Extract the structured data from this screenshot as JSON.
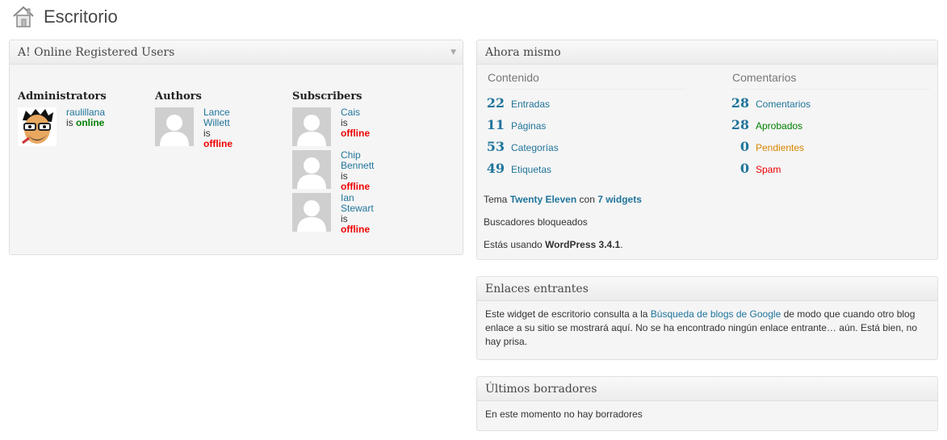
{
  "page": {
    "title": "Escritorio"
  },
  "online_users": {
    "title": "A! Online Registered Users",
    "columns": [
      {
        "title": "Administrators",
        "users": [
          {
            "name": "raulillana",
            "prefix": "is",
            "status": "online"
          }
        ]
      },
      {
        "title": "Authors",
        "users": [
          {
            "name": "Lance Willett",
            "prefix": "is",
            "status": "offline"
          }
        ]
      },
      {
        "title": "Subscribers",
        "users": [
          {
            "name": "Cais",
            "prefix": "is",
            "status": "offline"
          },
          {
            "name": "Chip Bennett",
            "prefix": "is",
            "status": "offline"
          },
          {
            "name": "Ian Stewart",
            "prefix": "is",
            "status": "offline"
          }
        ]
      }
    ]
  },
  "right_now": {
    "title": "Ahora mismo",
    "content_header": "Contenido",
    "comments_header": "Comentarios",
    "content": [
      {
        "count": "22",
        "label": "Entradas"
      },
      {
        "count": "11",
        "label": "Páginas"
      },
      {
        "count": "53",
        "label": "Categorías"
      },
      {
        "count": "49",
        "label": "Etiquetas"
      }
    ],
    "comments": [
      {
        "count": "28",
        "label": "Comentarios"
      },
      {
        "count": "28",
        "label": "Aprobados"
      },
      {
        "count": "0",
        "label": "Pendientes"
      },
      {
        "count": "0",
        "label": "Spam"
      }
    ],
    "theme_prefix": "Tema",
    "theme_name": "Twenty Eleven",
    "theme_mid": "con",
    "widgets": "7 widgets",
    "search_engines": "Buscadores bloqueados",
    "version_prefix": "Estás usando",
    "version": "WordPress 3.4.1",
    "version_suffix": "."
  },
  "incoming_links": {
    "title": "Enlaces entrantes",
    "text_before": "Este widget de escritorio consulta a la ",
    "link": "Búsqueda de blogs de Google",
    "text_after": " de modo que cuando otro blog enlace a su sitio se mostrará aquí. No se ha encontrado ningún enlace entrante… aún. Está bien, no hay prisa."
  },
  "recent_drafts": {
    "title": "Últimos borradores",
    "text": "En este momento no hay borradores"
  }
}
